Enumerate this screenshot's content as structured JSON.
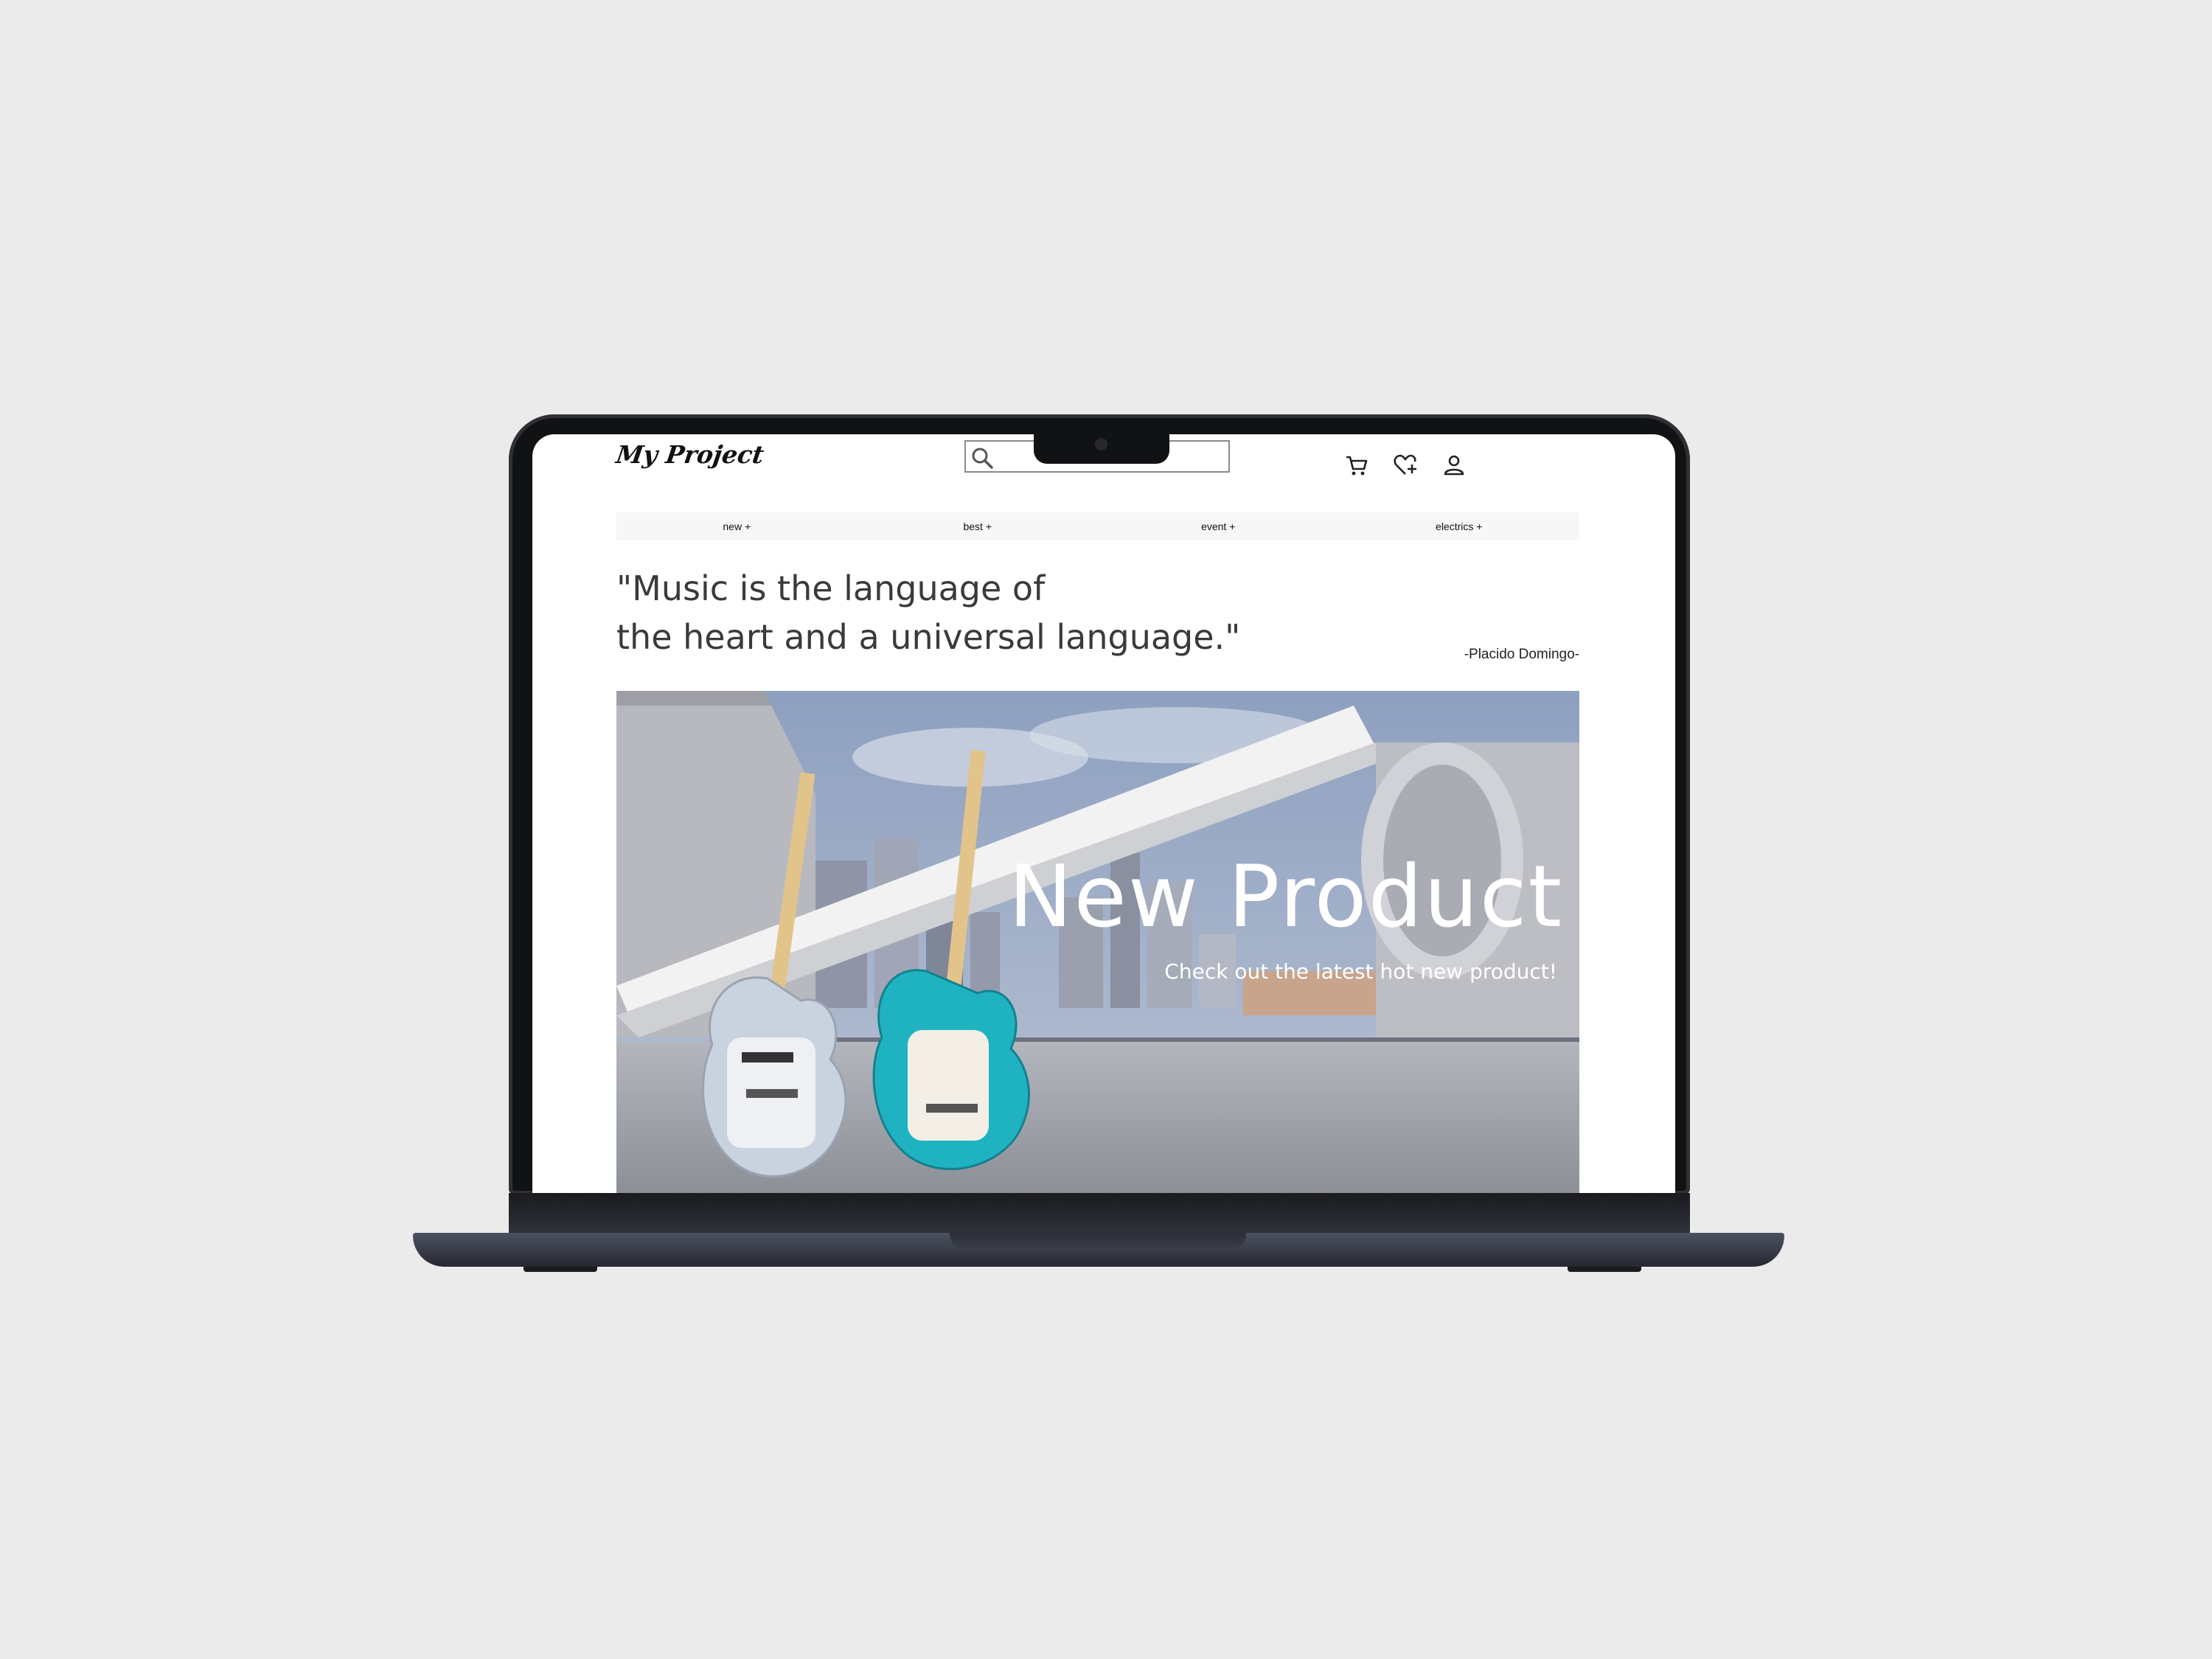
{
  "site": {
    "logo": "My Project",
    "search": {
      "placeholder": ""
    },
    "header_icons": [
      "cart-icon",
      "wishlist-heart-icon",
      "user-icon"
    ]
  },
  "nav": {
    "items": [
      {
        "label": "new +"
      },
      {
        "label": "best +"
      },
      {
        "label": "event +"
      },
      {
        "label": "electrics +"
      }
    ]
  },
  "quote": {
    "line1": "\"Music is the language of",
    "line2": "the heart and a universal language.\"",
    "author": "-Placido Domingo-"
  },
  "hero": {
    "title": "New Product",
    "subtitle": "Check out the latest hot new product!",
    "image_subject": "two electric guitars (silver and teal) on a rooftop with city skyline"
  },
  "colors": {
    "page_background": "#ebebeb",
    "laptop_bezel": "#111214",
    "nav_background": "#f7f7f7",
    "teal_guitar": "#1fb3c2",
    "silver_guitar": "#c9d2df"
  }
}
